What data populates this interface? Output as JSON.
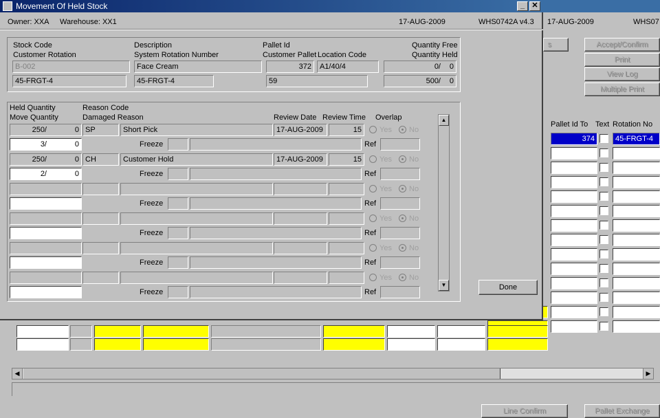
{
  "window": {
    "title": "Movement Of Held Stock",
    "owner": "Owner:  XXA",
    "warehouse": "Warehouse:  XX1",
    "date": "17-AUG-2009",
    "version": "WHS0742A  v4.3",
    "minimize": "_",
    "close": "✕"
  },
  "background": {
    "date": "17-AUG-2009",
    "form_id": "WHS07",
    "buttons": {
      "s_label": "s",
      "accept_confirm": "Accept/Confirm",
      "print": "Print",
      "view_log": "View Log",
      "multiple_print": "Multiple Print",
      "line_confirm": "Line Confirm",
      "pallet_exchange": "Pallet Exchange"
    },
    "headers": {
      "pallet_id_to": "Pallet Id To",
      "text": "Text",
      "rotation_no": "Rotation No"
    },
    "selected_row": {
      "pallet_id_to": "374",
      "rotation_no": "45-FRGT-4"
    }
  },
  "stock": {
    "labels": {
      "stock_code": "Stock Code",
      "customer_rotation": "Customer Rotation",
      "description": "Description",
      "system_rotation_number": "System Rotation Number",
      "pallet_id": "Pallet Id",
      "customer_pallet": "Customer Pallet",
      "location_code": "Location Code",
      "quantity_free": "Quantity Free",
      "quantity_held": "Quantity Held"
    },
    "values": {
      "stock_code": "B-002",
      "description": "Face Cream",
      "pallet_id": "372",
      "location_code": "A1/40/4",
      "quantity_free": "0/",
      "quantity_free_2": "0",
      "customer_rotation": "45-FRGT-4",
      "system_rotation_number": "45-FRGT-4",
      "customer_pallet": "59",
      "quantity_held": "500/",
      "quantity_held_2": "0"
    }
  },
  "held": {
    "labels": {
      "held_quantity": "Held Quantity",
      "move_quantity": "Move Quantity",
      "reason_code": "Reason Code",
      "damaged_reason": "Damaged Reason",
      "review_date": "Review Date",
      "review_time": "Review Time",
      "overlap": "Overlap",
      "freeze": "Freeze",
      "ref": "Ref",
      "yes": "Yes",
      "no": "No"
    },
    "rows": [
      {
        "held": "250/",
        "held2": "0",
        "code": "SP",
        "reason": "Short Pick",
        "date": "17-AUG-2009",
        "time": "15",
        "move": "3/",
        "move2": "0"
      },
      {
        "held": "250/",
        "held2": "0",
        "code": "CH",
        "reason": "Customer Hold",
        "date": "17-AUG-2009",
        "time": "15",
        "move": "2/",
        "move2": "0"
      }
    ],
    "done": "Done"
  }
}
